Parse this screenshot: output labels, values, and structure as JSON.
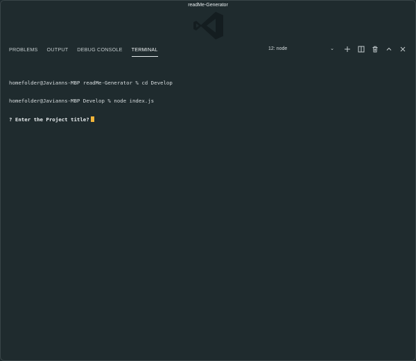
{
  "window": {
    "title": "readMe-Generator"
  },
  "panel": {
    "tabs": [
      "PROBLEMS",
      "OUTPUT",
      "DEBUG CONSOLE",
      "TERMINAL"
    ],
    "active_tab": "TERMINAL",
    "terminal_select": "12: node",
    "icons": [
      "plus-icon",
      "split-icon",
      "trash-icon",
      "chevron-up-icon",
      "close-icon"
    ]
  },
  "terminal": {
    "lines": [
      "homefolder@Javianns-MBP readMe-Generator % cd Develop",
      "homefolder@Javianns-MBP Develop % node index.js"
    ],
    "prompt": "? Enter the Project title?"
  },
  "colors": {
    "background": "#1f2b2e",
    "cursor": "#f2b53a"
  }
}
